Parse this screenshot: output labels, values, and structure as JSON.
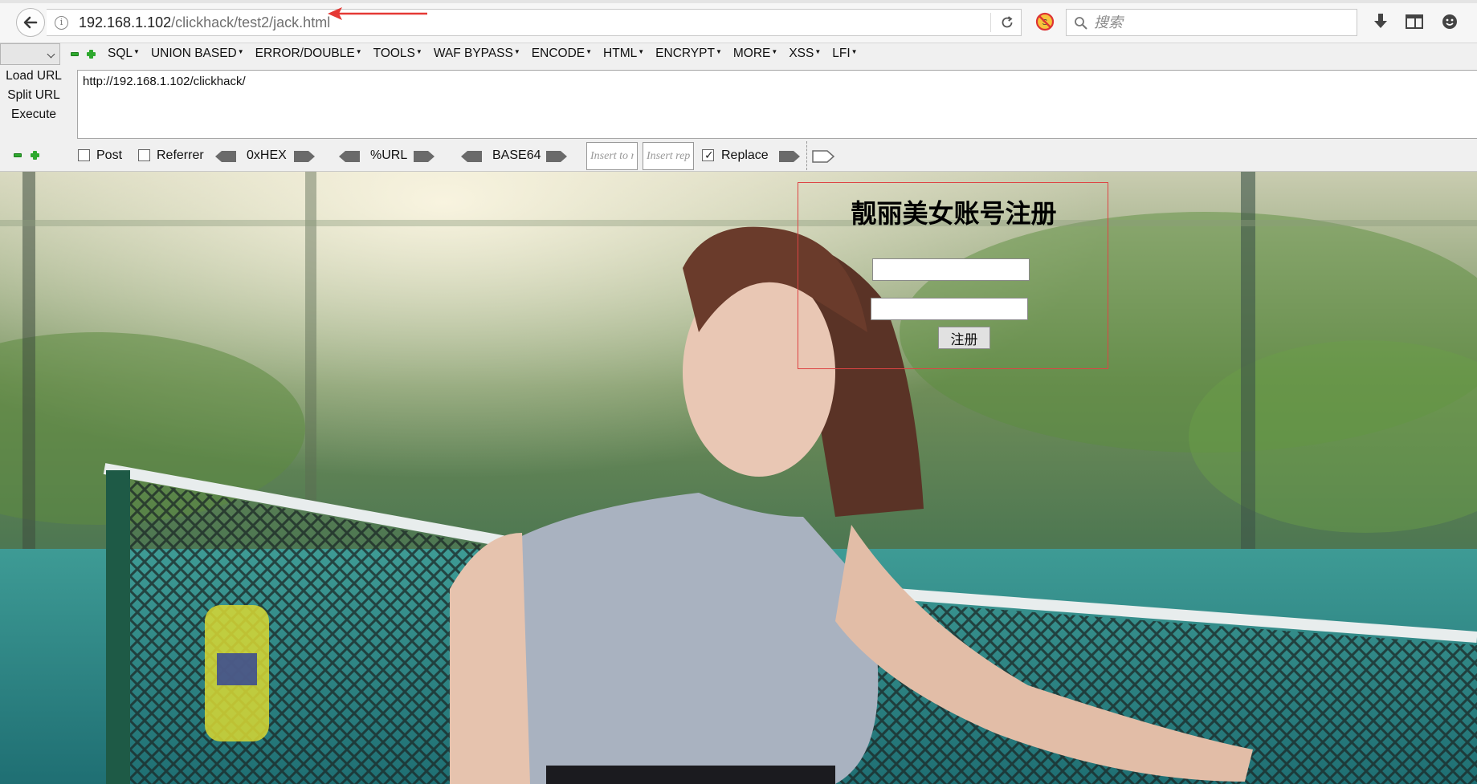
{
  "browser": {
    "url_host": "192.168.1.102",
    "url_path": "/clickhack/test2/jack.html",
    "search_placeholder": "搜索"
  },
  "hackbar": {
    "menu": [
      "SQL",
      "UNION BASED",
      "ERROR/DOUBLE",
      "TOOLS",
      "WAF BYPASS",
      "ENCODE",
      "HTML",
      "ENCRYPT",
      "MORE",
      "XSS",
      "LFI"
    ],
    "side_buttons": {
      "load_url": "Load URL",
      "split_url": "Split URL",
      "execute": "Execute"
    },
    "url_value": "http://192.168.1.102/clickhack/",
    "post_label": "Post",
    "referrer_label": "Referrer",
    "hex_label": "0xHEX",
    "url_label": "%URL",
    "base64_label": "BASE64",
    "insert_to_placeholder": "Insert to replace",
    "insert_rep_placeholder": "Insert replacing",
    "replace_label": "Replace",
    "replace_checked": true
  },
  "page": {
    "title": "靓丽美女账号注册",
    "submit_label": "注册"
  },
  "colors": {
    "accent_red": "#e53935",
    "hackbar_green": "#2ea82e",
    "frame_border": "#dd4444"
  },
  "icons": [
    "back-arrow-icon",
    "info-icon",
    "reload-icon",
    "noscript-icon",
    "search-icon",
    "download-icon",
    "library-icon",
    "feedback-icon",
    "minus-icon",
    "plus-icon",
    "arrow-left-icon",
    "arrow-right-icon"
  ]
}
